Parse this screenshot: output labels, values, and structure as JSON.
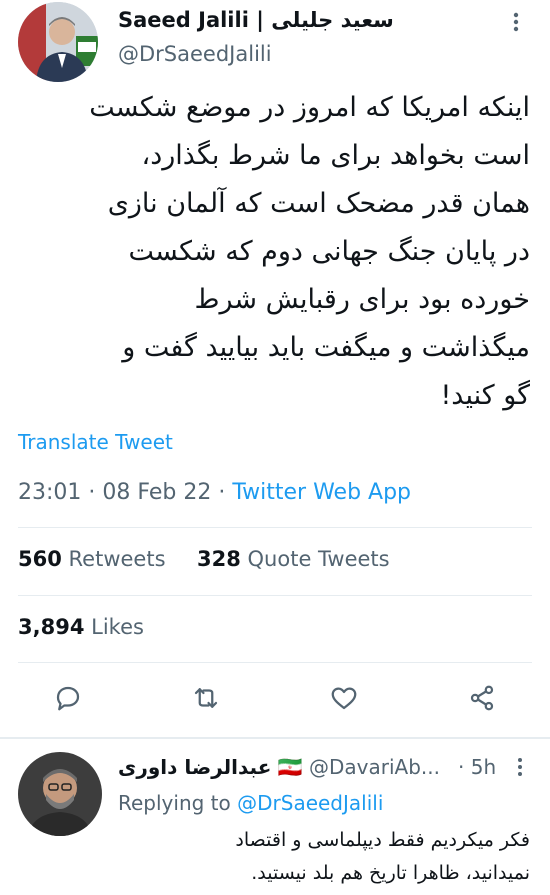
{
  "tweet": {
    "author_name": "Saeed Jalili | سعید جلیلی",
    "handle": "@DrSaeedJalili",
    "text": "اینکه امریکا که امروز در موضع شکست\nاست بخواهد برای ما شرط بگذارد،\nهمان قدر مضحک است که آلمان نازی\nدر پایان جنگ جهانی دوم که شکست\nخورده بود برای رقبایش شرط\nمیگذاشت و میگفت باید بیایید گفت و\nگو کنید!",
    "translate_label": "Translate Tweet",
    "time": "23:01",
    "date": "08 Feb 22",
    "source": "Twitter Web App",
    "sep": "·",
    "retweets_count": "560",
    "retweets_label": "Retweets",
    "quotes_count": "328",
    "quotes_label": "Quote Tweets",
    "likes_count": "3,894",
    "likes_label": "Likes"
  },
  "reply": {
    "author_name": "عبدالرضا داوری",
    "flag": "🇮🇷",
    "handle": "@DavariAb...",
    "time": "· 5h",
    "replying_prefix": "Replying to",
    "replying_handle": "@DrSaeedJalili",
    "text": "فکر میکردیم فقط دیپلماسی و اقتصاد\nنمیدانید، ظاهرا تاریخ هم بلد نیستید."
  },
  "colors": {
    "accent": "#1d9bf0",
    "muted": "#536471",
    "text": "#0f1419"
  },
  "icons": [
    "more-icon",
    "reply-icon",
    "retweet-icon",
    "like-icon",
    "share-icon"
  ]
}
